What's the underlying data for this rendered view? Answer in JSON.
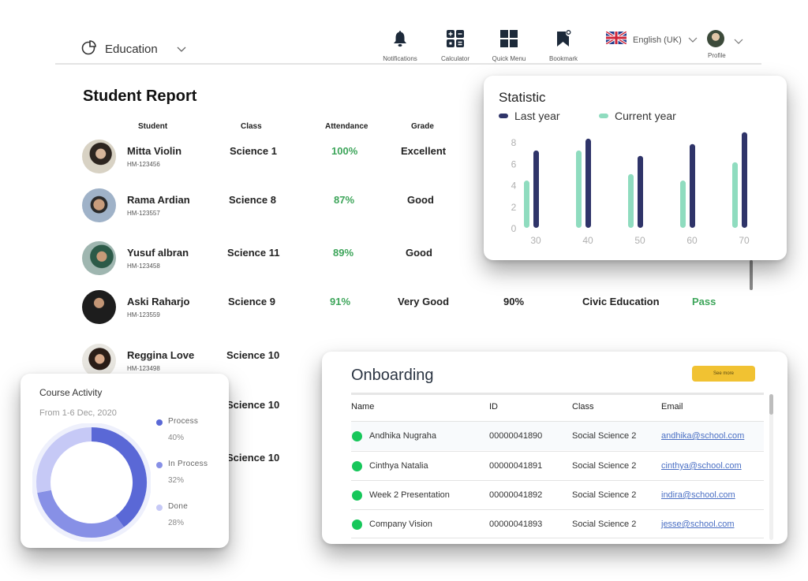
{
  "header": {
    "brand_label": "Education",
    "nav": [
      {
        "label": "Notifications",
        "icon": "bell-icon"
      },
      {
        "label": "Calculator",
        "icon": "calculator-icon"
      },
      {
        "label": "Quick Menu",
        "icon": "grid-icon"
      },
      {
        "label": "Bookmark",
        "icon": "bookmark-icon"
      }
    ],
    "language": "English (UK)",
    "profile_label": "Profile"
  },
  "report": {
    "title": "Student Report",
    "columns": [
      "Student",
      "Class",
      "Attendance",
      "Grade"
    ],
    "rows": [
      {
        "name": "Mitta Violin",
        "id": "HM-123456",
        "class": "Science 1",
        "attendance": "100%",
        "grade": "Excellent"
      },
      {
        "name": "Rama Ardian",
        "id": "HM-123557",
        "class": "Science 8",
        "attendance": "87%",
        "grade": "Good"
      },
      {
        "name": "Yusuf albran",
        "id": "HM-123458",
        "class": "Science 11",
        "attendance": "89%",
        "grade": "Good"
      },
      {
        "name": "Aski Raharjo",
        "id": "HM-123559",
        "class": "Science 9",
        "attendance": "91%",
        "grade": "Very Good",
        "score": "90%",
        "subject": "Civic Education",
        "result": "Pass"
      },
      {
        "name": "Reggina Love",
        "id": "HM-123498",
        "class": "Science 10"
      },
      {
        "class": "Science 10"
      },
      {
        "class": "Science 10"
      }
    ]
  },
  "statistic": {
    "title": "Statistic",
    "colors": {
      "last_year": "#2f3469",
      "current_year": "#8fdcbf"
    }
  },
  "chart_data": {
    "type": "bar",
    "title": "Statistic",
    "categories": [
      "30",
      "40",
      "50",
      "60",
      "70"
    ],
    "series": [
      {
        "name": "Current year",
        "values": [
          4.4,
          7.2,
          5.0,
          4.4,
          6.1
        ]
      },
      {
        "name": "Last year",
        "values": [
          7.2,
          8.3,
          6.7,
          7.8,
          8.9
        ]
      }
    ],
    "legend": [
      "Last year",
      "Current year"
    ],
    "legend_position": "top-left",
    "yticks": [
      0,
      2,
      4,
      6,
      8
    ],
    "ylim": [
      0,
      9
    ],
    "xlabel": "",
    "ylabel": "",
    "grid": false
  },
  "course_activity": {
    "title": "Course Activity",
    "subtitle": "From 1-6 Dec, 2020",
    "segments": [
      {
        "label": "Process",
        "value": 40,
        "display": "40%",
        "color": "#5a68d6"
      },
      {
        "label": "In Process",
        "value": 32,
        "display": "32%",
        "color": "#8790e6"
      },
      {
        "label": "Done",
        "value": 28,
        "display": "28%",
        "color": "#c6c9f6"
      }
    ]
  },
  "onboarding": {
    "title": "Onboarding",
    "see_more_label": "See more",
    "columns": [
      "Name",
      "ID",
      "Class",
      "Email"
    ],
    "rows": [
      {
        "name": "Andhika Nugraha",
        "id": "00000041890",
        "class": "Social Science 2",
        "email": "andhika@school.com"
      },
      {
        "name": "Cinthya Natalia",
        "id": "00000041891",
        "class": "Social Science 2",
        "email": "cinthya@school.com"
      },
      {
        "name": "Week 2 Presentation",
        "id": "00000041892",
        "class": "Social Science 2",
        "email": "indira@school.com"
      },
      {
        "name": "Company Vision",
        "id": "00000041893",
        "class": "Social Science 2",
        "email": "jesse@school.com"
      }
    ]
  }
}
